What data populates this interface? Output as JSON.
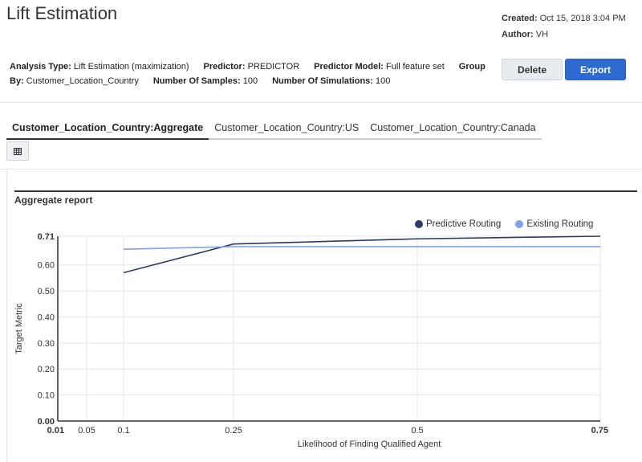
{
  "header": {
    "title": "Lift Estimation",
    "created_label": "Created:",
    "created_value": "Oct 15, 2018 3:04 PM",
    "author_label": "Author:",
    "author_value": "VH"
  },
  "analysis": {
    "analysis_type_label": "Analysis Type:",
    "analysis_type_value": "Lift Estimation (maximization)",
    "predictor_label": "Predictor:",
    "predictor_value": "PREDICTOR",
    "predictor_model_label": "Predictor Model:",
    "predictor_model_value": "Full feature set",
    "group_by_label_1": "Group",
    "group_by_label_2": "By:",
    "group_by_value": "Customer_Location_Country",
    "samples_label": "Number Of Samples:",
    "samples_value": "100",
    "simulations_label": "Number Of Simulations:",
    "simulations_value": "100"
  },
  "actions": {
    "delete_label": "Delete",
    "export_label": "Export"
  },
  "tabs": [
    {
      "label": "Customer_Location_Country:Aggregate",
      "active": true
    },
    {
      "label": "Customer_Location_Country:US",
      "active": false
    },
    {
      "label": "Customer_Location_Country:Canada",
      "active": false
    }
  ],
  "view_icon": "table-icon",
  "report": {
    "title": "Aggregate report"
  },
  "colors": {
    "predictive": "#2b3a67",
    "existing": "#7ea3e6",
    "export_button": "#2e6bd0"
  },
  "chart_data": {
    "type": "line",
    "xlabel": "Likelihood of Finding Qualified Agent",
    "ylabel": "Target Metric",
    "x_ticks": [
      "0.01",
      "0.05",
      "0.1",
      "0.25",
      "0.5",
      "0.75"
    ],
    "y_ticks": [
      "0.00",
      "0.10",
      "0.20",
      "0.30",
      "0.40",
      "0.50",
      "0.60",
      "0.71"
    ],
    "ylim": [
      0,
      0.71
    ],
    "grid": true,
    "legend_position": "top-right",
    "series": [
      {
        "name": "Predictive Routing",
        "x": [
          0.1,
          0.25,
          0.5,
          0.75
        ],
        "values": [
          0.57,
          0.68,
          0.7,
          0.71
        ]
      },
      {
        "name": "Existing Routing",
        "x": [
          0.1,
          0.25,
          0.5,
          0.75
        ],
        "values": [
          0.66,
          0.67,
          0.67,
          0.67
        ]
      }
    ]
  }
}
